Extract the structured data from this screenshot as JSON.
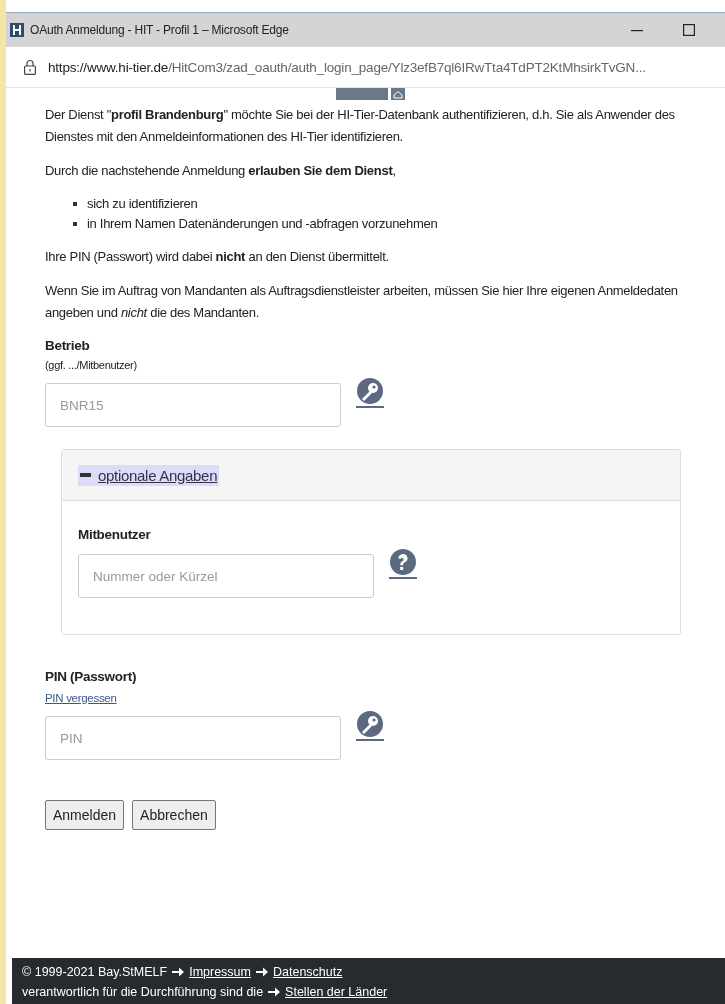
{
  "window": {
    "title": "OAuth Anmeldung - HIT - Profil 1 – Microsoft Edge",
    "url_host": "https://www.hi-tier.de",
    "url_path": "/HitCom3/zad_oauth/auth_login_page/Ylz3efB7ql6IRwTta4TdPT2KtMhsirkTvGN..."
  },
  "blocks": [
    {
      "kind": "paragraph",
      "text": "Der Dienst \"**profil Brandenburg**\" möchte Sie bei der HI-Tier-Datenbank authentifizieren, d.h. Sie als Anwender des Dienstes mit den Anmeldeinformationen des HI-Tier identifizieren."
    },
    {
      "kind": "paragraph",
      "text": "Durch die nachstehende Anmeldung **erlauben Sie dem Dienst**,"
    },
    {
      "kind": "list",
      "items": [
        "sich zu identifizieren",
        "in Ihrem Namen Datenänderungen und -abfragen vorzunehmen"
      ]
    },
    {
      "kind": "paragraph",
      "text": "Ihre PIN (Passwort) wird dabei **nicht** an den Dienst übermittelt."
    },
    {
      "kind": "paragraph",
      "text": "Wenn Sie im Auftrag von Mandanten als Auftragsdienstleister arbeiten, müssen Sie hier Ihre eigenen Anmeldedaten angeben und *nicht* die des Mandanten."
    }
  ],
  "betrieb": {
    "label": "Betrieb",
    "hint": "(ggf. .../Mitbenutzer)",
    "placeholder": "BNR15"
  },
  "optional": {
    "toggle": "optionale Angaben",
    "expanded": true,
    "label": "Mitbenutzer",
    "placeholder": "Nummer oder Kürzel"
  },
  "pin": {
    "label": "PIN (Passwort)",
    "link": "PIN vergessen",
    "placeholder": "PIN"
  },
  "buttons": [
    "Anmelden",
    "Abbrechen"
  ],
  "footer": [
    {
      "text": "© 1999-2021 Bay.StMELF",
      "links": [
        "Impressum",
        "Datenschutz"
      ]
    },
    {
      "text": "verantwortlich für die Durchführung sind die",
      "links": [
        "Stellen der Länder"
      ]
    }
  ]
}
